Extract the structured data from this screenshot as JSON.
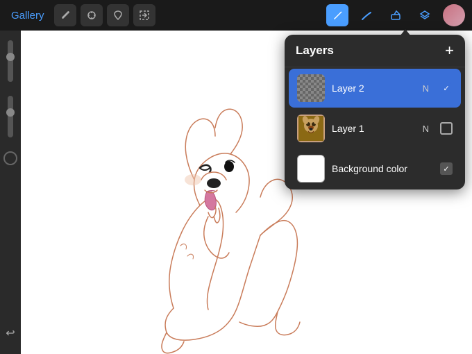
{
  "toolbar": {
    "gallery_label": "Gallery",
    "icons": [
      {
        "name": "wrench-icon",
        "symbol": "🔧"
      },
      {
        "name": "adjust-icon",
        "symbol": "✦"
      },
      {
        "name": "selection-icon",
        "symbol": "S"
      },
      {
        "name": "transform-icon",
        "symbol": "↗"
      }
    ],
    "right_icons": [
      {
        "name": "pen-icon",
        "symbol": "✏",
        "active": true
      },
      {
        "name": "smudge-icon",
        "symbol": "⌀",
        "active": false
      },
      {
        "name": "eraser-icon",
        "symbol": "⬜",
        "active": false
      },
      {
        "name": "layers-icon",
        "symbol": "▪",
        "active": false
      }
    ],
    "avatar_label": "User avatar"
  },
  "layers_panel": {
    "title": "Layers",
    "add_button": "+",
    "layers": [
      {
        "id": "layer2",
        "name": "Layer 2",
        "blend_mode": "N",
        "active": true,
        "checked": true,
        "thumb_type": "transparent"
      },
      {
        "id": "layer1",
        "name": "Layer 1",
        "blend_mode": "N",
        "active": false,
        "checked": false,
        "thumb_type": "dog"
      },
      {
        "id": "bg",
        "name": "Background color",
        "blend_mode": "",
        "active": false,
        "checked": true,
        "thumb_type": "white"
      }
    ]
  },
  "sidebar": {
    "undo_label": "↩"
  }
}
